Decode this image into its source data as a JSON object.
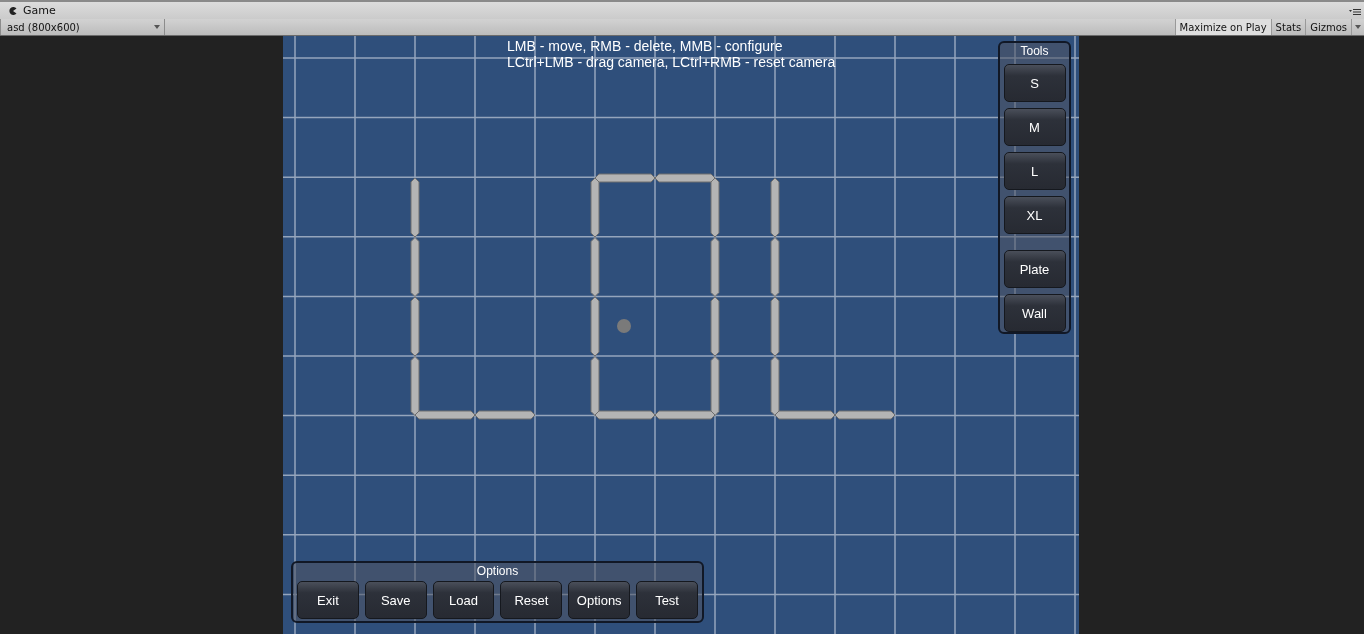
{
  "window": {
    "tab_title": "Game"
  },
  "toolbar": {
    "aspect": "asd (800x600)",
    "buttons": [
      "Maximize on Play",
      "Stats",
      "Gizmos"
    ]
  },
  "instructions": [
    "LMB - move, RMB - delete, MMB - configure",
    "LCtrl+LMB - drag camera, LCtrl+RMB - reset camera"
  ],
  "tools_panel": {
    "title": "Tools",
    "groups": [
      [
        "S",
        "M",
        "L",
        "XL"
      ],
      [
        "Plate",
        "Wall"
      ]
    ]
  },
  "options_panel": {
    "title": "Options",
    "buttons": [
      "Exit",
      "Save",
      "Load",
      "Reset",
      "Options",
      "Test"
    ]
  }
}
